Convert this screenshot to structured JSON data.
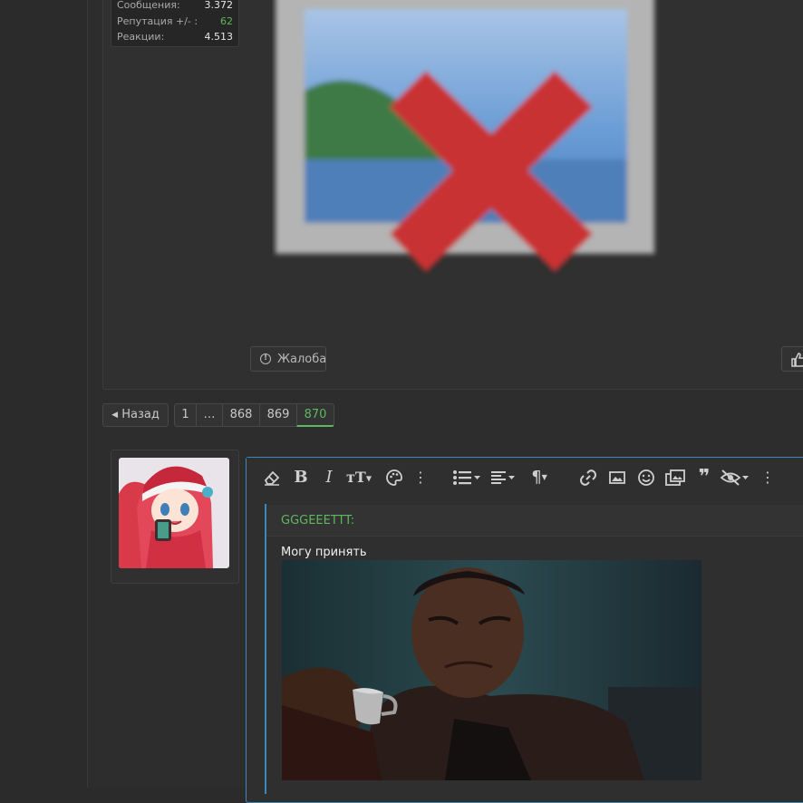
{
  "user_stats": [
    {
      "label": "Сообщения:",
      "value": "3.372",
      "accent": false
    },
    {
      "label": "Репутация +/- :",
      "value": "62",
      "accent": true
    },
    {
      "label": "Реакции:",
      "value": "4.513",
      "accent": false
    }
  ],
  "post": {
    "report_label": "Жалоба",
    "broken_image_icon": "broken-image-icon",
    "like_icon": "thumbs-up-icon"
  },
  "pagination": {
    "back_label": "Назад",
    "pages": [
      "1",
      "…",
      "868",
      "869",
      "870"
    ],
    "current": "870"
  },
  "editor": {
    "toolbar_icons": [
      "eraser-icon",
      "bold-icon",
      "italic-icon",
      "text-size-icon",
      "palette-icon",
      "more-icon",
      "list-icon",
      "align-icon",
      "paragraph-icon",
      "link-icon",
      "image-icon",
      "smiley-icon",
      "media-icon",
      "quote-icon",
      "hide-icon",
      "more-icon"
    ],
    "quote_author": "GGGEEETTT:",
    "body_text": "Могу принять"
  },
  "colors": {
    "accent_green": "#5fb75f",
    "editor_border": "#3e87bb",
    "background": "#2b2b2b"
  }
}
